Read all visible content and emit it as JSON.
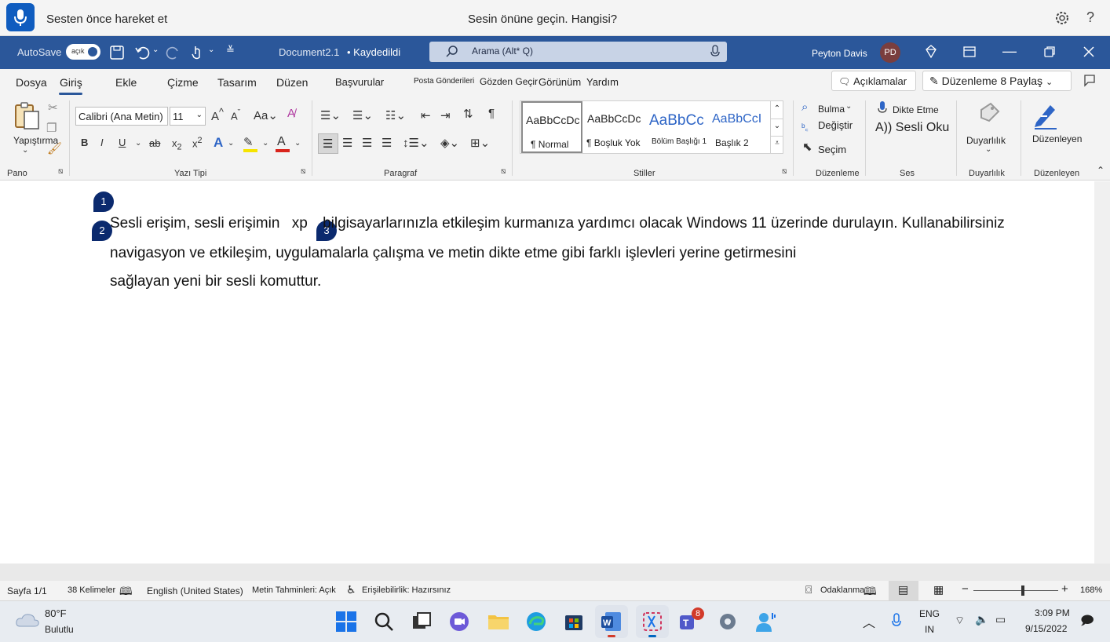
{
  "voice_access": {
    "status": "Sesten önce hareket et",
    "hint": "Sesin önüne geçin. Hangisi?",
    "help": "?"
  },
  "titlebar": {
    "autosave_label": "AutoSave",
    "autosave_state": "açık",
    "document_name": "Document2.1",
    "saved_state": "• Kaydedildi",
    "search_placeholder": "Arama (Alt* Q)",
    "user_name": "Peyton Davis",
    "user_initials": "PD"
  },
  "tabs": [
    "Dosya",
    "Giriş",
    "Ekle",
    "Çizme",
    "Tasarım",
    "Düzen",
    "Başvurular",
    "Posta Gönderileri",
    "Gözden Geçir",
    "Görünüm",
    "Yardım"
  ],
  "ribbon_top": {
    "comments": "Açıklamalar",
    "editing": "Düzenleme",
    "share": "8 Paylaş"
  },
  "ribbon": {
    "paste": "Yapıştırma",
    "font_name": "Calibri (Ana Metin)",
    "font_size": "11",
    "styles": [
      {
        "preview": "AaBbCcDc",
        "name": "¶ Normal"
      },
      {
        "preview": "AaBbCcDc",
        "name": "¶ Boşluk Yok"
      },
      {
        "preview": "AaBbCc",
        "name": "Bölüm Başlığı 1"
      },
      {
        "preview": "AaBbCcI",
        "name": "Başlık 2"
      }
    ],
    "find": "Bulma",
    "replace": "Değiştir",
    "select": "Seçim",
    "dictate": "Dikte Etme",
    "read_aloud": "A)) Sesli Oku",
    "sensitivity": "Duyarlılık",
    "editor": "Düzenleyen",
    "groups": {
      "clipboard": "Pano",
      "font": "Yazı Tipi",
      "paragraph": "Paragraf",
      "styles": "Stiller",
      "editing": "Düzenleme",
      "voice": "Ses",
      "sensitivity": "Duyarlılık",
      "editor": "Düzenleyen"
    }
  },
  "document": {
    "badges": [
      "1",
      "2",
      "3"
    ],
    "line1_a": "Sesli erişim, sesli erişimin",
    "line1_b": "xp",
    "line1_c": "bilgisayarlarınızla etkileşim kurmanıza yardımcı olacak Windows 11 üzerinde durulayın. Kullanabilirsiniz",
    "line2": "navigasyon ve etkileşim, uygulamalarla çalışma ve metin dikte etme gibi farklı işlevleri yerine getirmesini",
    "line3": "sağlayan yeni bir sesli komuttur."
  },
  "statusbar": {
    "page": "Sayfa 1/1",
    "words": "38 Kelimeler",
    "language": "English (United States)",
    "predictions": "Metin Tahminleri: Açık",
    "accessibility": "Erişilebilirlik: Hazırsınız",
    "focus": "Odaklanma",
    "zoom": "168%"
  },
  "taskbar": {
    "temp": "80°F",
    "weather": "Bulutlu",
    "lang_top": "ENG",
    "lang_bottom": "IN",
    "time": "3:09 PM",
    "date": "9/15/2022",
    "teams_badge": "8"
  },
  "colors": {
    "word_blue": "#2b579a",
    "badge_navy": "#0b2a6e",
    "voice_blue": "#0f5cbf"
  }
}
